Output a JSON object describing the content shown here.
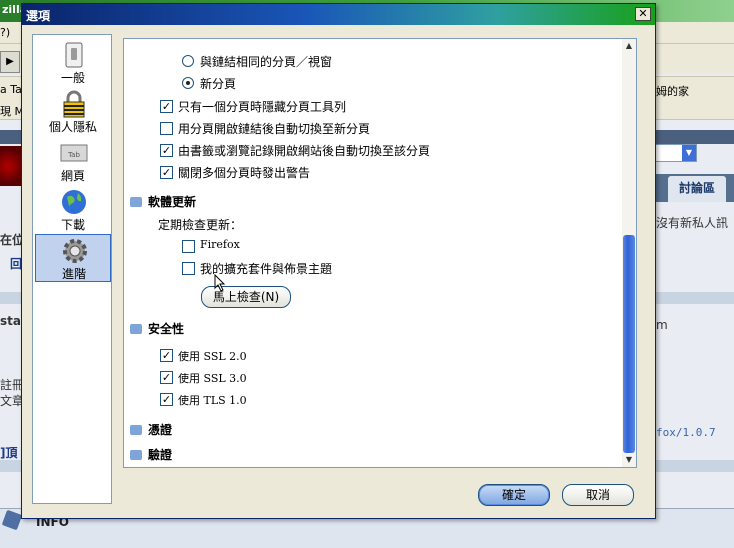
{
  "background_window": {
    "title_fragment": "zilla",
    "menu_fragment": "?)",
    "bookmark_fragment_1": "a Ta",
    "bookmark_fragment_2": "現 M",
    "bookmark_right": "姆的家",
    "tab_label": "討論區",
    "text_messages": "沒有新私人訊",
    "left_frag_1": "在位",
    "left_frag_2": "回",
    "left_frag_3": "sta",
    "left_frag_4": "註冊",
    "left_frag_5": "文章",
    "left_frag_6": "]頂",
    "right_frag_1": "m",
    "right_frag_2": "fox/1.0.7",
    "info_label": "INFO"
  },
  "dialog": {
    "title": "選項",
    "close_glyph": "✕",
    "sidebar": [
      {
        "label": "一般",
        "icon": "switch-icon",
        "selected": false
      },
      {
        "label": "個人隱私",
        "icon": "padlock-icon",
        "selected": false
      },
      {
        "label": "網頁",
        "icon": "tab-icon",
        "selected": false
      },
      {
        "label": "下載",
        "icon": "globe-icon",
        "selected": false
      },
      {
        "label": "進階",
        "icon": "gear-icon",
        "selected": true
      }
    ],
    "tabs_section": {
      "radio_same_window": "與鏈結相同的分頁／視窗",
      "radio_new_tab": "新分頁",
      "options": [
        {
          "label": "只有一個分頁時隱藏分頁工具列",
          "checked": true
        },
        {
          "label": "用分頁開啟鏈結後自動切換至新分頁",
          "checked": false
        },
        {
          "label": "由書籤或瀏覽記錄開啟網站後自動切換至該分頁",
          "checked": true
        },
        {
          "label": "關閉多個分頁時發出警告",
          "checked": true
        }
      ]
    },
    "update_section": {
      "title": "軟體更新",
      "subtitle": "定期檢查更新：",
      "items": [
        {
          "label": "Firefox",
          "checked": false
        },
        {
          "label": "我的擴充套件與佈景主題",
          "checked": false
        }
      ],
      "check_now_button": "馬上檢查(N)"
    },
    "security_section": {
      "title": "安全性",
      "items": [
        {
          "label": "使用 SSL 2.0",
          "checked": true
        },
        {
          "label": "使用 SSL 3.0",
          "checked": true
        },
        {
          "label": "使用 TLS 1.0",
          "checked": true
        }
      ]
    },
    "cert_section": {
      "title": "憑證"
    },
    "validation_section": {
      "title": "驗證"
    },
    "ok_button": "確定",
    "cancel_button": "取消",
    "colors": {
      "accent": "#316ac5",
      "titlebar": "#0a246a",
      "scroll_thumb": "#2f63d6"
    }
  }
}
